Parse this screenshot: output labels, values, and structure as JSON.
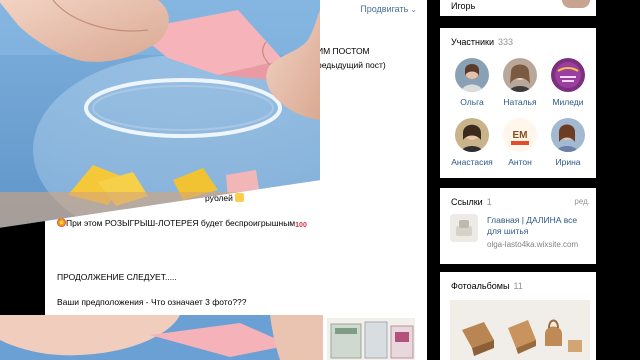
{
  "feed": {
    "promote_label": "Продвигать",
    "lines": [
      "ИМ ПОСТОМ",
      "редыдущий пост)",
      "рублей",
      "При этом РОЗЫГРЫШ-ЛОТЕРЕЯ будет беспроигрышным",
      "ПРОДОЛЖЕНИЕ СЛЕДУЕТ.....",
      "Ваши предположения - Что означает 3 фото???"
    ]
  },
  "sidebar": {
    "user_name": "Игорь",
    "members": {
      "title": "Участники",
      "count": "333",
      "people": [
        {
          "name": "Ольга"
        },
        {
          "name": "Наталья"
        },
        {
          "name": "Миледи"
        },
        {
          "name": "Анастасия"
        },
        {
          "name": "Антон"
        },
        {
          "name": "Ирина"
        }
      ],
      "logo_text": "ЕМ"
    },
    "links": {
      "title": "Ссылки",
      "count": "1",
      "edit_label": "ред.",
      "item_title": "Главная | ДАЛИНА все для шитья",
      "item_url": "olga-lasto4ka.wixsite.com"
    },
    "albums": {
      "title": "Фотоальбомы",
      "count": "11"
    }
  },
  "colors": {
    "link": "#2a5885",
    "muted": "#939393",
    "background": "#000000"
  }
}
